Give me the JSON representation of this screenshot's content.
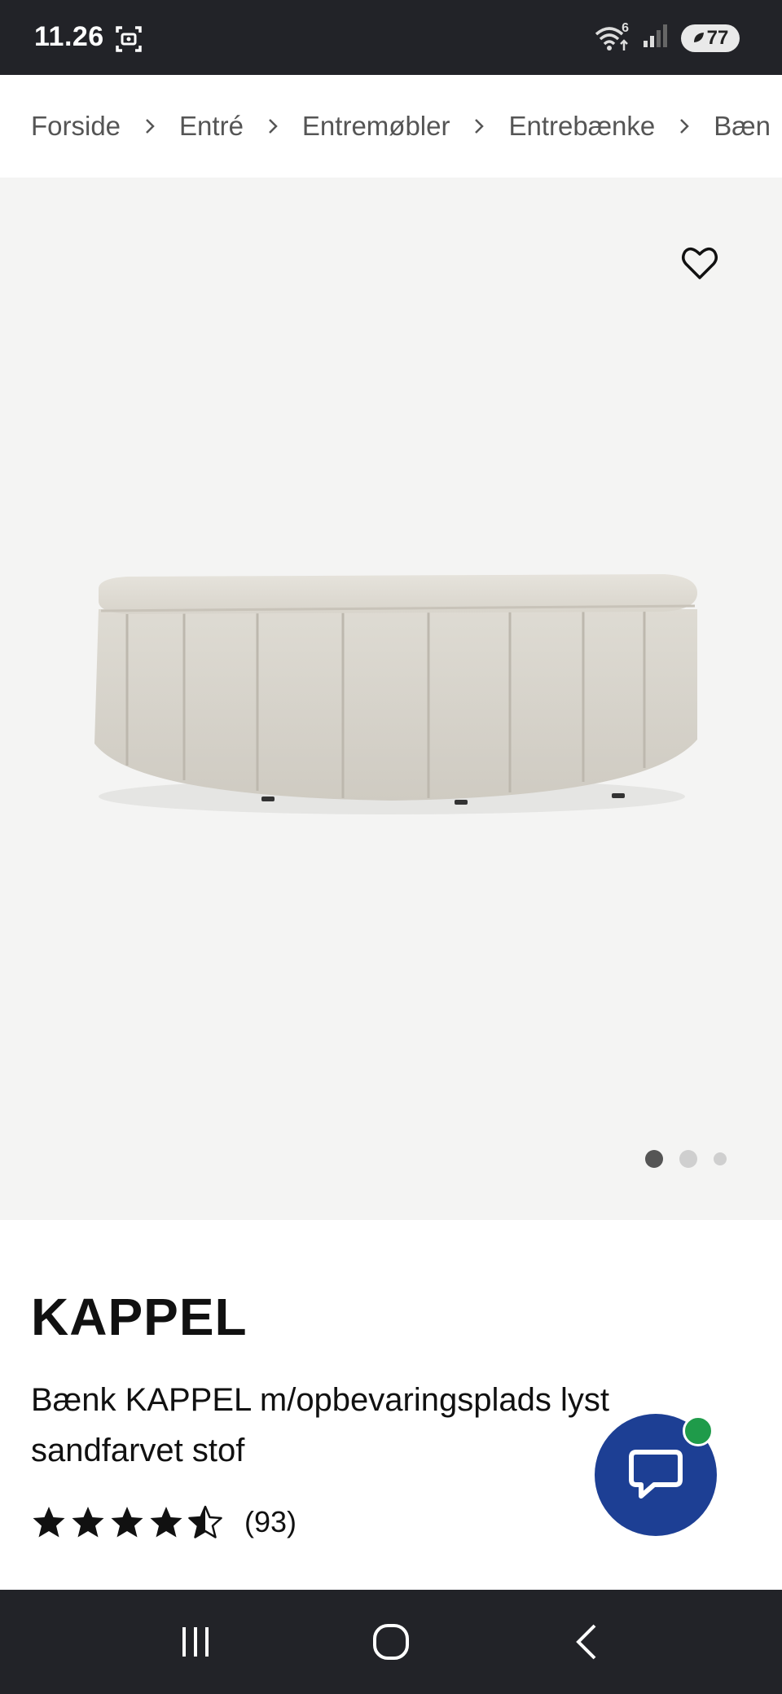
{
  "status_bar": {
    "time": "11.26",
    "wifi_badge": "6",
    "battery": "77"
  },
  "breadcrumb": {
    "items": [
      "Forside",
      "Entré",
      "Entremøbler",
      "Entrebænke",
      "Bæn"
    ]
  },
  "gallery": {
    "favorite_icon": "heart-outline-icon",
    "image_count": 3,
    "active_index": 0
  },
  "product": {
    "title": "KAPPEL",
    "description": "Bænk KAPPEL m/opbevaringsplads lyst sandfarvet stof",
    "rating": 4.5,
    "review_count": "(93)"
  },
  "chat": {
    "icon": "chat-bubble-icon",
    "online_color": "#1f9b4a",
    "button_color": "#1d3f94"
  },
  "nav": {
    "recent_icon": "recent-apps-icon",
    "home_icon": "home-icon",
    "back_icon": "back-icon"
  }
}
